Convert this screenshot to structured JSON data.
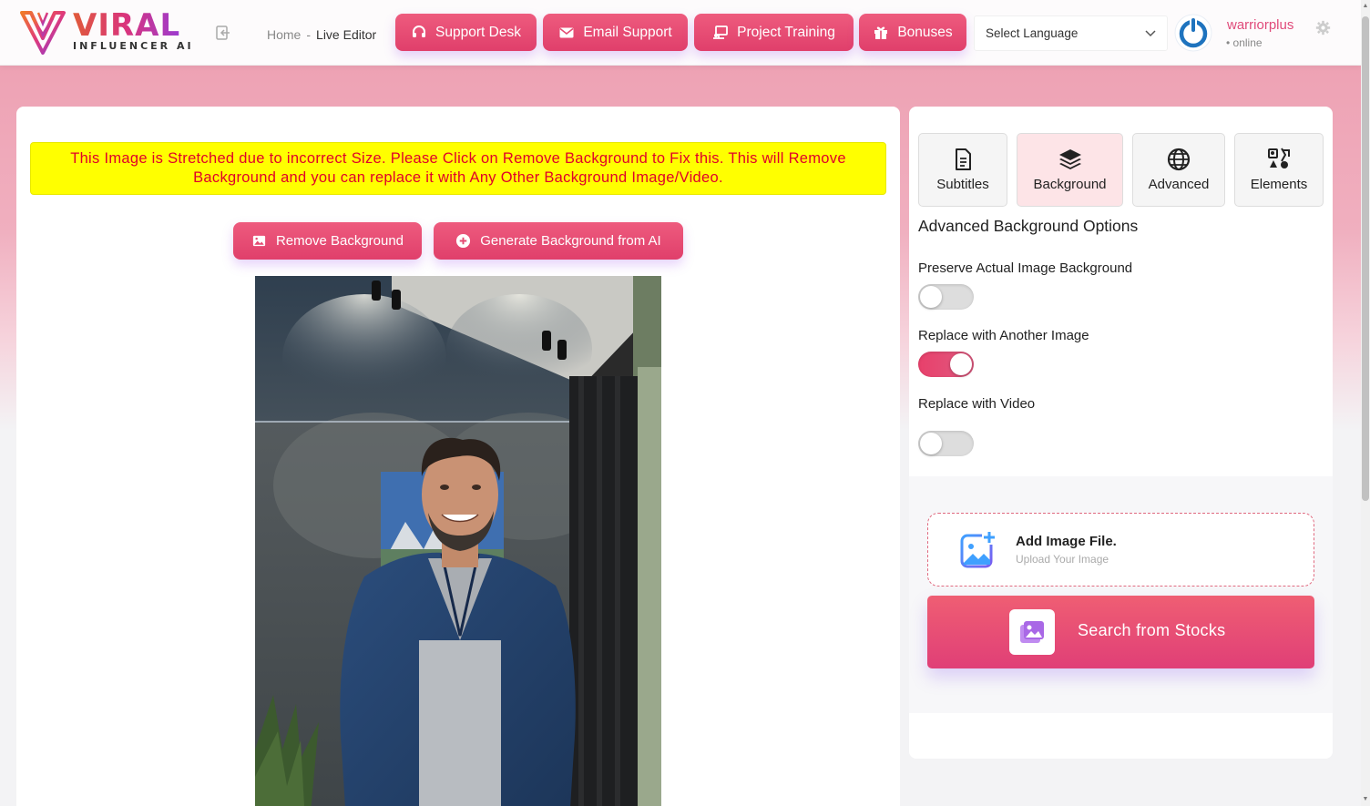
{
  "brand": {
    "name": "VIRAL",
    "sub": "INFLUENCER AI"
  },
  "breadcrumb": {
    "home": "Home",
    "separator": "-",
    "current": "Live Editor"
  },
  "header_buttons": [
    {
      "label": "Support Desk",
      "icon": "headset-icon"
    },
    {
      "label": "Email Support",
      "icon": "envelope-icon"
    },
    {
      "label": "Project Training",
      "icon": "monitor-icon"
    },
    {
      "label": "Bonuses",
      "icon": "gift-icon"
    }
  ],
  "language": {
    "selected": "Select Language"
  },
  "user": {
    "name": "warriorplus",
    "status": "• online"
  },
  "editor": {
    "warning": "This Image is Stretched due to incorrect Size. Please Click on Remove Background to Fix this. This will Remove Background and you can replace it with Any Other Background Image/Video.",
    "remove_bg_label": "Remove Background",
    "generate_bg_label": "Generate Background from AI"
  },
  "tabs": [
    {
      "label": "Subtitles",
      "icon": "document-icon",
      "active": false
    },
    {
      "label": "Background",
      "icon": "layers-icon",
      "active": true
    },
    {
      "label": "Advanced",
      "icon": "globe-icon",
      "active": false
    },
    {
      "label": "Elements",
      "icon": "shapes-icon",
      "active": false
    }
  ],
  "background_options": {
    "title": "Advanced Background Options",
    "options": [
      {
        "label": "Preserve Actual Image Background",
        "enabled": false
      },
      {
        "label": "Replace with Another Image",
        "enabled": true
      },
      {
        "label": "Replace with Video",
        "enabled": false
      }
    ]
  },
  "upload": {
    "title": "Add Image File.",
    "subtitle": "Upload Your Image"
  },
  "stocks": {
    "label": "Search from Stocks"
  },
  "colors": {
    "accent": "#e8466f",
    "warning_bg": "#ffff00",
    "warning_text": "#e0002a"
  }
}
